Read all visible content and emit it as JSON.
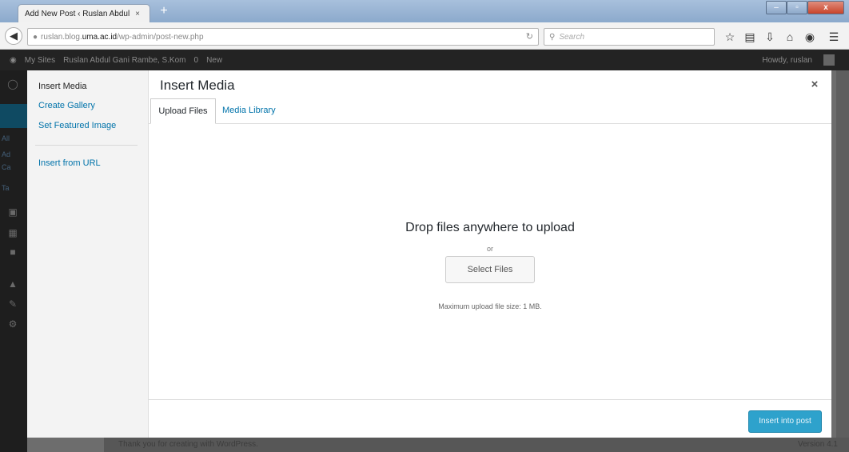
{
  "browser": {
    "tab_title": "Add New Post ‹ Ruslan Abdul ...",
    "tab_close": "×",
    "new_tab": "+",
    "window_controls": {
      "minimize": "‒",
      "maximize": "▫",
      "close": "x"
    },
    "url": {
      "host": "ruslan.blog.",
      "domain": "uma.ac.id",
      "path": "/wp-admin/post-new.php"
    },
    "search_placeholder": "Search",
    "icons": [
      "star-icon",
      "reading-list-icon",
      "download-icon",
      "home-icon",
      "pocket-icon",
      "menu-icon"
    ]
  },
  "adminbar": {
    "items": [
      "My Sites",
      "Ruslan Abdul Gani Rambe, S.Kom",
      "0",
      "New"
    ],
    "howdy": "Howdy, ruslan"
  },
  "sidemenu_text": [
    "All",
    "Ad",
    "Ca",
    "Ta"
  ],
  "modal": {
    "title": "Insert Media",
    "close": "×",
    "menu": {
      "insert_media": "Insert Media",
      "create_gallery": "Create Gallery",
      "set_featured_image": "Set Featured Image",
      "insert_from_url": "Insert from URL"
    },
    "tabs": {
      "upload_files": "Upload Files",
      "media_library": "Media Library"
    },
    "uploader": {
      "drop_text": "Drop files anywhere to upload",
      "or": "or",
      "select_files": "Select Files",
      "max_size": "Maximum upload file size: 1 MB."
    },
    "insert_button": "Insert into post"
  },
  "footer": {
    "left": "Thank you for creating with WordPress.",
    "version": "Version 4.1"
  },
  "colors": {
    "accent": "#0073aa",
    "primary_button": "#2ea2cc",
    "adminbar": "#232323"
  }
}
